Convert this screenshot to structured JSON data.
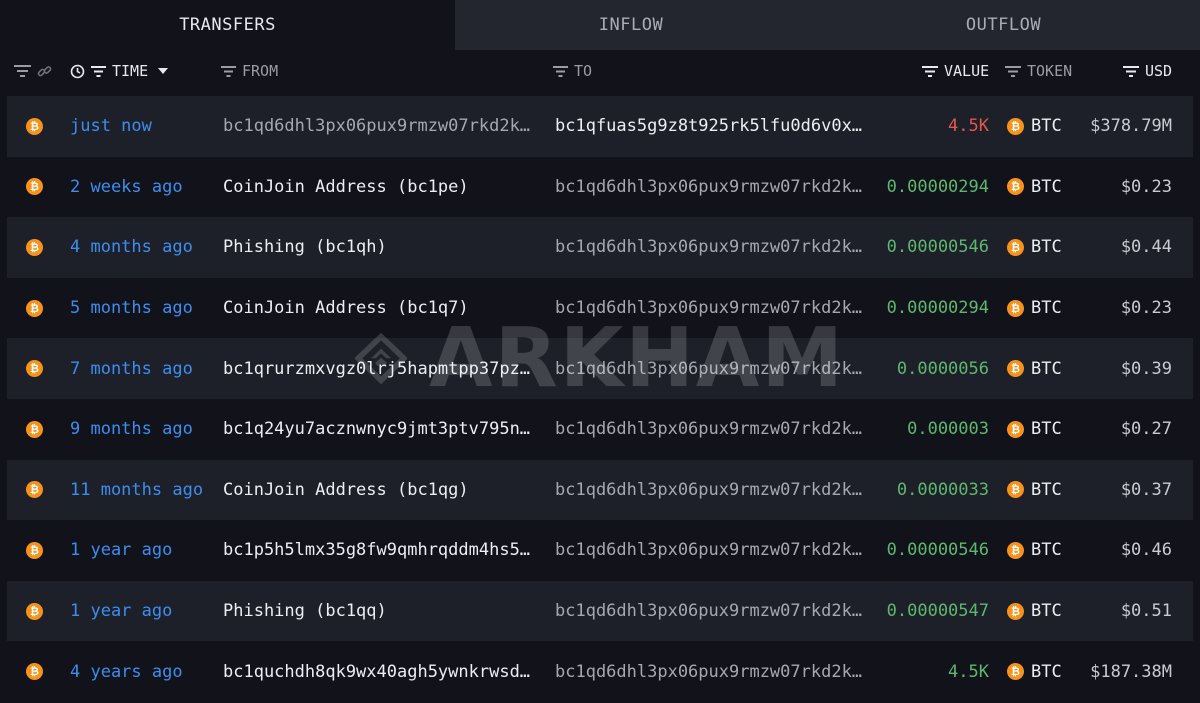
{
  "tabs": [
    {
      "label": "TRANSFERS",
      "active": true
    },
    {
      "label": "INFLOW",
      "active": false
    },
    {
      "label": "OUTFLOW",
      "active": false
    }
  ],
  "columns": {
    "time": "TIME",
    "from": "FROM",
    "to": "TO",
    "value": "VALUE",
    "token": "TOKEN",
    "usd": "USD"
  },
  "watermark": "ARKHAM",
  "rows": [
    {
      "time": "just now",
      "from": "bc1qd6dhl3px06pux9rmzw07rkd2k…",
      "to": "bc1qfuas5g9z8t925rk5lfu0d6v0x…",
      "value": "4.5K",
      "direction": "out",
      "token": "BTC",
      "usd": "$378.79M"
    },
    {
      "time": "2 weeks ago",
      "from": "CoinJoin Address (bc1pe)",
      "to": "bc1qd6dhl3px06pux9rmzw07rkd2k…",
      "value": "0.00000294",
      "direction": "in",
      "token": "BTC",
      "usd": "$0.23"
    },
    {
      "time": "4 months ago",
      "from": "Phishing (bc1qh)",
      "to": "bc1qd6dhl3px06pux9rmzw07rkd2k…",
      "value": "0.00000546",
      "direction": "in",
      "token": "BTC",
      "usd": "$0.44"
    },
    {
      "time": "5 months ago",
      "from": "CoinJoin Address (bc1q7)",
      "to": "bc1qd6dhl3px06pux9rmzw07rkd2k…",
      "value": "0.00000294",
      "direction": "in",
      "token": "BTC",
      "usd": "$0.23"
    },
    {
      "time": "7 months ago",
      "from": "bc1qrurzmxvgz0lrj5hapmtpp37pz…",
      "to": "bc1qd6dhl3px06pux9rmzw07rkd2k…",
      "value": "0.0000056",
      "direction": "in",
      "token": "BTC",
      "usd": "$0.39"
    },
    {
      "time": "9 months ago",
      "from": "bc1q24yu7acznwnyc9jmt3ptv795n…",
      "to": "bc1qd6dhl3px06pux9rmzw07rkd2k…",
      "value": "0.000003",
      "direction": "in",
      "token": "BTC",
      "usd": "$0.27"
    },
    {
      "time": "11 months ago",
      "from": "CoinJoin Address (bc1qg)",
      "to": "bc1qd6dhl3px06pux9rmzw07rkd2k…",
      "value": "0.0000033",
      "direction": "in",
      "token": "BTC",
      "usd": "$0.37"
    },
    {
      "time": "1 year ago",
      "from": "bc1p5h5lmx35g8fw9qmhrqddm4hs5…",
      "to": "bc1qd6dhl3px06pux9rmzw07rkd2k…",
      "value": "0.00000546",
      "direction": "in",
      "token": "BTC",
      "usd": "$0.46"
    },
    {
      "time": "1 year ago",
      "from": "Phishing (bc1qq)",
      "to": "bc1qd6dhl3px06pux9rmzw07rkd2k…",
      "value": "0.00000547",
      "direction": "in",
      "token": "BTC",
      "usd": "$0.51"
    },
    {
      "time": "4 years ago",
      "from": "bc1quchdh8qk9wx40agh5ywnkrwsd…",
      "to": "bc1qd6dhl3px06pux9rmzw07rkd2k…",
      "value": "4.5K",
      "direction": "in",
      "token": "BTC",
      "usd": "$187.38M"
    }
  ],
  "icons": {
    "filter": "filter-icon",
    "link": "link-icon",
    "clock": "clock-icon",
    "sort": "caret-down-icon",
    "token": "bitcoin-icon"
  },
  "colors": {
    "inflow": "#5cb86e",
    "outflow": "#e5564c",
    "time_link": "#3b8ef0",
    "btc": "#f7931a"
  }
}
